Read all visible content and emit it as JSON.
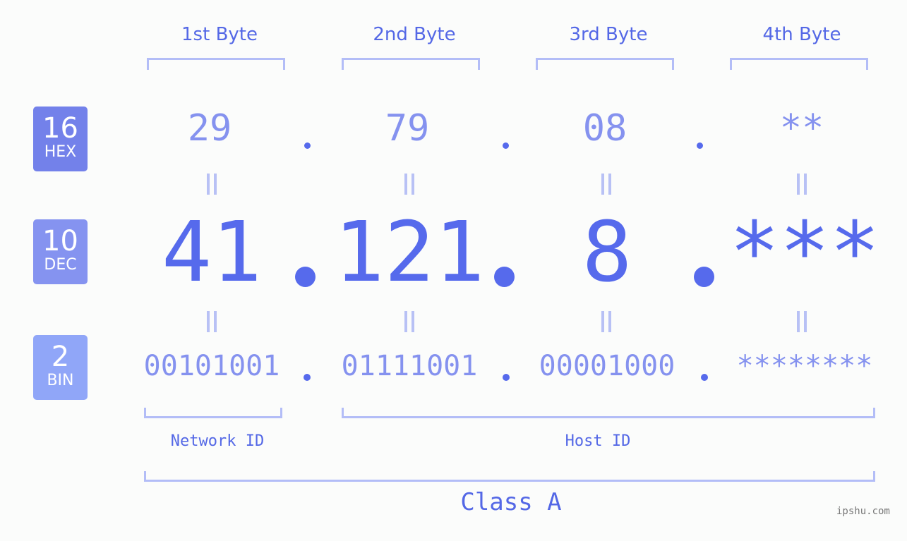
{
  "bytes": [
    {
      "label": "1st Byte",
      "hex": "29",
      "dec": "41",
      "bin": "00101001"
    },
    {
      "label": "2nd Byte",
      "hex": "79",
      "dec": "121",
      "bin": "01111001"
    },
    {
      "label": "3rd Byte",
      "hex": "08",
      "dec": "8",
      "bin": "00001000"
    },
    {
      "label": "4th Byte",
      "hex": "**",
      "dec": "***",
      "bin": "********"
    }
  ],
  "badges": {
    "hex": {
      "num": "16",
      "label": "HEX",
      "color": "#7381ea"
    },
    "dec": {
      "num": "10",
      "label": "DEC",
      "color": "#8593f0"
    },
    "bin": {
      "num": "2",
      "label": "BIN",
      "color": "#90a6f8"
    }
  },
  "network_id_label": "Network ID",
  "host_id_label": "Host ID",
  "class_label": "Class A",
  "watermark": "ipshu.com",
  "colors": {
    "accent": "#566aec",
    "light": "#8592ef",
    "bracket": "#b3bdf7"
  }
}
